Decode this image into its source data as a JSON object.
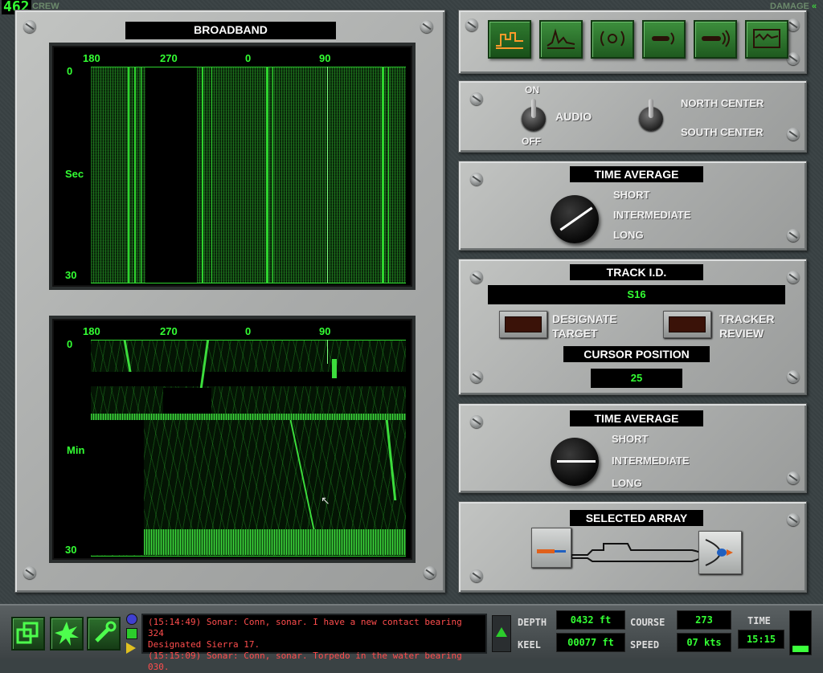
{
  "hud": {
    "counter": "462",
    "crew_tab": "CREW",
    "damage_tab": "DAMAGE"
  },
  "broadband": {
    "title": "BROADBAND",
    "top_display": {
      "bearings": [
        "180",
        "270",
        "0",
        "90"
      ],
      "y_top": "0",
      "y_mid": "Sec",
      "y_bottom": "30"
    },
    "bottom_display": {
      "bearings": [
        "180",
        "270",
        "0",
        "90"
      ],
      "y_top": "0",
      "y_mid": "Min",
      "y_bottom": "30"
    }
  },
  "display_modes": [
    {
      "name": "broadband-mode",
      "active": true
    },
    {
      "name": "narrowband-mode",
      "active": false
    },
    {
      "name": "active-sonar-mode",
      "active": false
    },
    {
      "name": "towed-array-mode",
      "active": false
    },
    {
      "name": "sphere-array-mode",
      "active": false
    },
    {
      "name": "waterfall-mode",
      "active": false
    }
  ],
  "audio": {
    "on_label": "ON",
    "off_label": "OFF",
    "audio_label": "AUDIO",
    "north_label": "NORTH CENTER",
    "south_label": "SOUTH CENTER"
  },
  "time_average_1": {
    "title": "TIME AVERAGE",
    "options": [
      "SHORT",
      "INTERMEDIATE",
      "LONG"
    ]
  },
  "track": {
    "title": "TRACK I.D.",
    "id_value": "S16",
    "designate_label_1": "DESIGNATE",
    "designate_label_2": "TARGET",
    "tracker_label_1": "TRACKER",
    "tracker_label_2": "REVIEW",
    "cursor_title": "CURSOR POSITION",
    "cursor_value": "25"
  },
  "time_average_2": {
    "title": "TIME AVERAGE",
    "options": [
      "SHORT",
      "INTERMEDIATE",
      "LONG"
    ]
  },
  "selected_array": {
    "title": "SELECTED ARRAY"
  },
  "messages": [
    "(15:14:49) Sonar: Conn, sonar. I have a new contact bearing 324",
    "Designated Sierra 17.",
    "(15:15:09) Sonar: Conn, sonar. Torpedo in the water bearing 030."
  ],
  "nav": {
    "depth_label": "DEPTH",
    "depth_value": "0432  ft",
    "keel_label": "KEEL",
    "keel_value": "00077 ft",
    "course_label": "COURSE",
    "course_value": "273",
    "speed_label": "SPEED",
    "speed_value": "07  kts",
    "time_label": "TIME",
    "time_value": "15:15"
  },
  "colors": {
    "phosphor": "#33ff33",
    "message": "#ff4d4d",
    "panel": "#b0b2b1"
  }
}
